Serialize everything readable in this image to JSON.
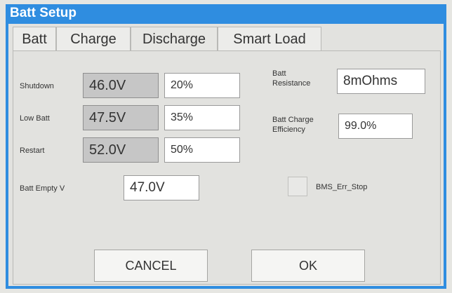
{
  "window": {
    "title": "Batt Setup"
  },
  "tabs": [
    {
      "label": "Batt"
    },
    {
      "label": "Charge"
    },
    {
      "label": "Discharge",
      "active": true
    },
    {
      "label": "Smart Load"
    }
  ],
  "discharge": {
    "shutdown": {
      "label": "Shutdown",
      "voltage": "46.0V",
      "percent": "20%"
    },
    "low_batt": {
      "label": "Low Batt",
      "voltage": "47.5V",
      "percent": "35%"
    },
    "restart": {
      "label": "Restart",
      "voltage": "52.0V",
      "percent": "50%"
    },
    "batt_empty": {
      "label": "Batt Empty V",
      "value": "47.0V"
    },
    "batt_resistance": {
      "label_line1": "Batt",
      "label_line2": "Resistance",
      "value": "8mOhms"
    },
    "batt_charge_efficiency": {
      "label_line1": "Batt Charge",
      "label_line2": "Efficiency",
      "value": "99.0%"
    },
    "bms_err_stop": {
      "label": "BMS_Err_Stop",
      "checked": false
    }
  },
  "buttons": {
    "cancel": "CANCEL",
    "ok": "OK"
  },
  "colors": {
    "titlebar": "#2f8de0",
    "readonly_field": "#c6c6c6",
    "edit_field": "#ffffff"
  }
}
